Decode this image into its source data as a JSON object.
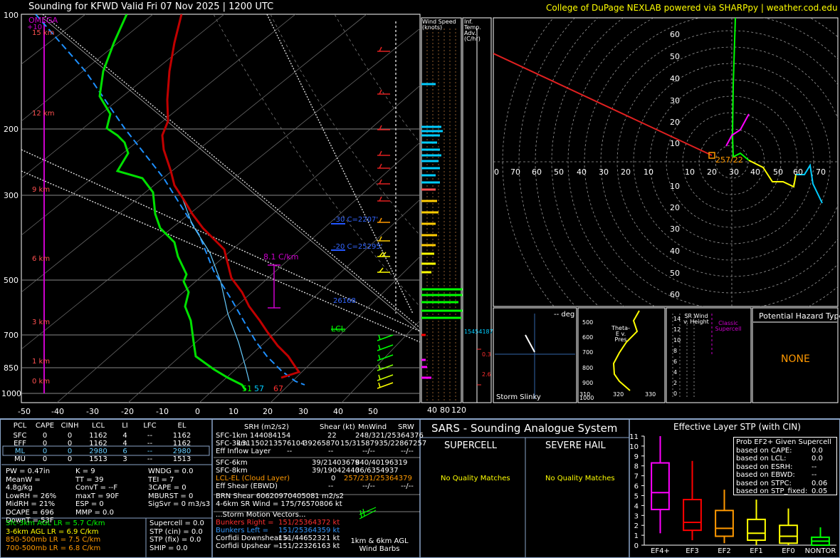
{
  "header": {
    "title": "Sounding for KFWD Valid  Fri 07 Nov 2025 | 1200 UTC",
    "credit": "College of DuPage NEXLAB powered via SHARPpy | weather.cod.edu"
  },
  "skewt": {
    "pressure_labels": [
      "100",
      "200",
      "300",
      "500",
      "700",
      "850",
      "1000"
    ],
    "height_labels": [
      "15 km",
      "12 km",
      "9 km",
      "6 km",
      "3 km",
      "1 km",
      "0 km"
    ],
    "temp_labels": [
      "-50",
      "-40",
      "-30",
      "-20",
      "-10",
      "0",
      "10",
      "20",
      "30",
      "40",
      "50"
    ],
    "omega_label": "OMEGA",
    "omega_value": "+10",
    "lapse_label": "8.1 C/km",
    "lcl_label": "LCL",
    "iso_minus30": "-30 C=2207'",
    "iso_minus20": "-20 C=25295'",
    "surface_temp": "67",
    "surface_dew": "51",
    "surface_wb": "57",
    "extra_label": "26168"
  },
  "wind_speed_panel": {
    "title": "Wind Speed (knots)",
    "ticks": [
      "40",
      "80",
      "120"
    ]
  },
  "inf_temp_panel": {
    "title": "Inf. Temp. Adv.(C/hr)",
    "value1": "0.3",
    "value2": "2.6",
    "value3": "15454187"
  },
  "hodograph": {
    "rings_x": [
      "0",
      "70",
      "60",
      "50",
      "40",
      "30",
      "20",
      "10",
      "10",
      "20",
      "30",
      "40",
      "50",
      "60",
      "70"
    ],
    "rings_y_up": [
      "60",
      "50",
      "40",
      "30",
      "20",
      "10"
    ],
    "rings_y_down": [
      "10",
      "20",
      "30",
      "40",
      "50",
      "60"
    ],
    "storm_label": "257/22"
  },
  "storm_slinky": {
    "deg": "-- deg",
    "label": "Storm Slinky"
  },
  "theta_panel": {
    "label": "Theta-E v. Pres",
    "ticks_y": [
      "500",
      "600",
      "700",
      "800",
      "900",
      "1000"
    ],
    "ticks_x": [
      "310",
      "320",
      "330"
    ]
  },
  "sr_wind": {
    "label": "SR Wind v. Height",
    "classic": "Classic Supercell",
    "ticks": [
      "14",
      "12",
      "10",
      "8",
      "6",
      "4",
      "2",
      "0"
    ]
  },
  "hazard": {
    "title": "Potential Hazard Type",
    "value": "NONE"
  },
  "parcel_table": {
    "headers": [
      "PCL",
      "CAPE",
      "CINH",
      "LCL",
      "LI",
      "LFC",
      "EL"
    ],
    "rows": [
      [
        "SFC",
        "0",
        "0",
        "1162",
        "4",
        "--",
        "1162"
      ],
      [
        "EFF",
        "0",
        "0",
        "1162",
        "4",
        "--",
        "1162"
      ],
      [
        "ML",
        "0",
        "0",
        "2980",
        "6",
        "--",
        "2980"
      ],
      [
        "MU",
        "0",
        "0",
        "1513",
        "3",
        "--",
        "1513"
      ]
    ]
  },
  "indices": {
    "col1": [
      "PW = 0.47in",
      "MeanW = 4.8g/kg",
      "LowRH = 26%",
      "MidRH = 21%",
      "DCAPE = 696",
      "DownT = 53F"
    ],
    "col2": [
      "K = 9",
      "TT = 39",
      "ConvT = --F",
      "maxT = 90F",
      "ESP = 0",
      "MMP = 0.0"
    ],
    "col3": [
      "WNDG = 0.0",
      "TEI = 7",
      "3CAPE = 0",
      "MBURST = 0",
      "",
      "SigSvr = 0 m3/s3"
    ]
  },
  "lapse_rates": [
    {
      "text": "Sfc-3km AGL LR = 5.7 C/km",
      "color": "#00ff00"
    },
    {
      "text": "3-6km AGL LR = 6.9 C/km",
      "color": "#ffff00"
    },
    {
      "text": "850-500mb LR = 7.5 C/km",
      "color": "#ff9900"
    },
    {
      "text": "700-500mb LR = 6.8 C/km",
      "color": "#ff9900"
    }
  ],
  "composite": [
    "Supercell = 0.0",
    "STP (cin) = 0.0",
    "STP (fix) = 0.0",
    "SHIP = 0.0"
  ],
  "kinematics": {
    "headers": [
      "SRH (m2/s2)",
      "Shear (kt)",
      "MnWind",
      "SRW"
    ],
    "rows": [
      [
        "SFC-1km",
        "144084154",
        "22",
        "248/321/25364376"
      ],
      [
        "SFC-3km",
        "131150213576104",
        "39265870",
        "15/31587935/22867257"
      ],
      [
        "Eff Inflow Layer",
        "--",
        "--",
        "--/--",
        "--/--"
      ],
      [
        "SFC-6km",
        "",
        "39/21403679",
        "840/40196319"
      ],
      [
        "SFC-8km",
        "",
        "39/19042440",
        "36/6354937"
      ],
      [
        "LCL-EL (Cloud Layer)",
        "",
        "0",
        "257/231/25364379"
      ],
      [
        "Eff Shear (EBWD)",
        "",
        "--",
        "--/--",
        "--/--"
      ]
    ],
    "brn": "BRN Shear 60620970405081 m2/s2",
    "sr46": "4-6km SR Wind =  175/76570806 kt",
    "storm_vectors": "...Storm Motion Vectors...",
    "bunkers_right_label": "Bunkers Right =",
    "bunkers_right": "151/25364372 kt",
    "bunkers_left_label": "Bunkers Left =",
    "bunkers_left": "151/25364359 kt",
    "corfidi_down_label": "Corfidi Downshear =",
    "corfidi_down": "151/44652321 kt",
    "corfidi_up_label": "Corfidi Upshear =",
    "corfidi_up": "151/22326163 kt",
    "barbs_label": "1km & 6km AGL Wind Barbs"
  },
  "sars": {
    "title": "SARS - Sounding Analogue System",
    "supercell": "SUPERCELL",
    "hail": "SEVERE HAIL",
    "no_match_1": "No Quality Matches",
    "no_match_2": "No Quality Matches"
  },
  "stp_panel": {
    "title": "Effective Layer STP (with CIN)",
    "prob_title": "Prob EF2+ Given Supercell",
    "prob_rows": [
      [
        "based on CAPE:",
        "0.0"
      ],
      [
        "based on LCL:",
        "0.0"
      ],
      [
        "based on ESRH:",
        "--"
      ],
      [
        "based on EBWD:",
        "--"
      ],
      [
        "based on STPC:",
        "0.06"
      ],
      [
        "based on STP_fixed:",
        "0.05"
      ]
    ]
  },
  "chart_data": {
    "type": "box",
    "categories": [
      "EF4+",
      "EF3",
      "EF2",
      "EF1",
      "EF0",
      "NONTOR"
    ],
    "colors": [
      "#ff00ff",
      "#ff0000",
      "#ff9900",
      "#ffff00",
      "#ffff00",
      "#00ff00"
    ],
    "boxes": [
      {
        "low": 1.2,
        "q1": 3.6,
        "median": 5.3,
        "q3": 8.3,
        "high": 11.0
      },
      {
        "low": 0.5,
        "q1": 1.5,
        "median": 2.3,
        "q3": 4.6,
        "high": 8.5
      },
      {
        "low": 0.2,
        "q1": 0.9,
        "median": 1.7,
        "q3": 3.5,
        "high": 5.6
      },
      {
        "low": 0.0,
        "q1": 0.5,
        "median": 1.2,
        "q3": 2.6,
        "high": 4.6
      },
      {
        "low": 0.0,
        "q1": 0.2,
        "median": 0.9,
        "q3": 2.0,
        "high": 3.7
      },
      {
        "low": 0.0,
        "q1": 0.0,
        "median": 0.4,
        "q3": 0.8,
        "high": 1.8
      }
    ],
    "yticks": [
      "0",
      "1",
      "2",
      "3",
      "4",
      "5",
      "6",
      "7",
      "8",
      "9",
      "10",
      "11"
    ],
    "ylim": [
      0,
      11
    ]
  }
}
